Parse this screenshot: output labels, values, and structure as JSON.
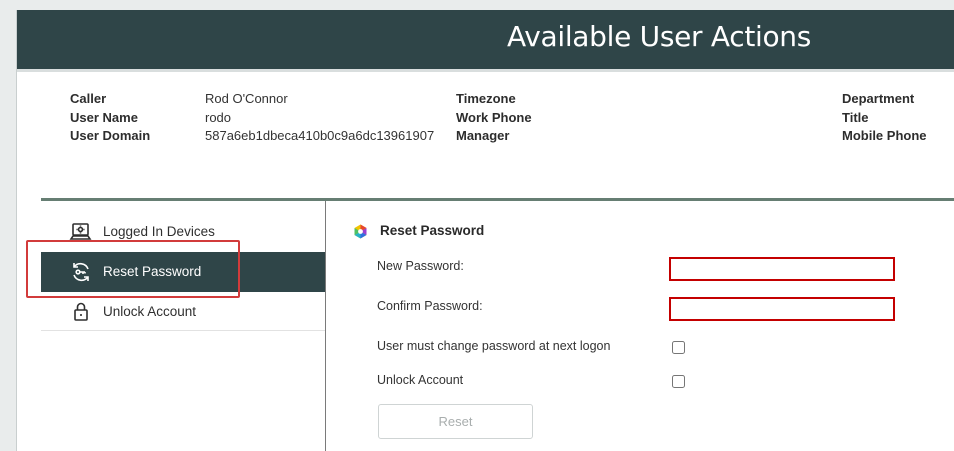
{
  "header": {
    "title": "Available User Actions"
  },
  "caller_info": {
    "col1": [
      {
        "label": "Caller",
        "value": "Rod O'Connor"
      },
      {
        "label": "User Name",
        "value": "rodo"
      },
      {
        "label": "User Domain",
        "value": "587a6eb1dbeca410b0c9a6dc13961907"
      }
    ],
    "col2": [
      {
        "label": "Timezone"
      },
      {
        "label": "Work Phone"
      },
      {
        "label": "Manager"
      }
    ],
    "col3": [
      {
        "label": "Department"
      },
      {
        "label": "Title"
      },
      {
        "label": "Mobile Phone"
      }
    ]
  },
  "nav": {
    "items": [
      {
        "label": "Logged In Devices",
        "icon": "laptop-settings-icon"
      },
      {
        "label": "Reset Password",
        "icon": "refresh-key-icon",
        "active": true
      },
      {
        "label": "Unlock Account",
        "icon": "lock-icon"
      }
    ]
  },
  "form": {
    "section_title": "Reset Password",
    "section_icon": "hexagon-color-icon",
    "new_password_label": "New Password:",
    "new_password_value": "",
    "confirm_password_label": "Confirm Password:",
    "confirm_password_value": "",
    "must_change_label": "User must change password at next logon",
    "must_change_checked": false,
    "unlock_label": "Unlock Account",
    "unlock_checked": false,
    "reset_button": "Reset"
  },
  "colors": {
    "header_bg": "#2f4548",
    "active_nav": "#2f4548",
    "separator": "#667e73",
    "error_border": "#c40000",
    "highlight": "#d23b3b"
  }
}
